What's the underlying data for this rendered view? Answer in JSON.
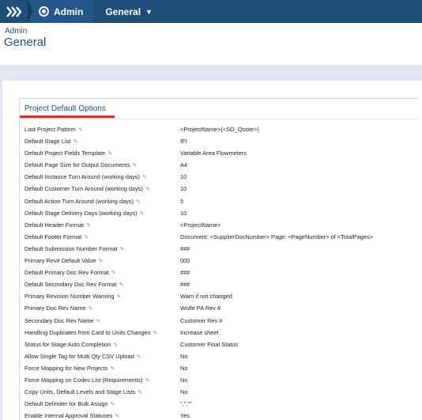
{
  "breadcrumb": {
    "items": [
      {
        "label": "Admin",
        "icon": "gear-icon"
      },
      {
        "label": "General",
        "icon": "chevron-down-icon"
      }
    ]
  },
  "header": {
    "subtitle": "Admin",
    "title": "General"
  },
  "section": {
    "title": "Project Default Options",
    "accent_color": "#e02b2b",
    "highlight_color": "#fbf58f"
  },
  "rows": [
    {
      "label": "Last Project Pattern",
      "value": "<ProjectName>(<SO_Quote>)"
    },
    {
      "label": "Default Stage List",
      "value": "IFI"
    },
    {
      "label": "Default Project Fields Template",
      "value": "Variable Area Flowmeters"
    },
    {
      "label": "Default Page Size for Output Documents",
      "value": "A4"
    },
    {
      "label": "Default Instance Turn Around (working days)",
      "value": "10"
    },
    {
      "label": "Default Customer Turn Around (working days)",
      "value": "10"
    },
    {
      "label": "Default Action Turn Around (working days)",
      "value": "5"
    },
    {
      "label": "Default Stage Delivery Days (working days)",
      "value": "10"
    },
    {
      "label": "Default Header Format",
      "value": "<ProjectName>"
    },
    {
      "label": "Default Footer Format",
      "value": "Document: <SupplierDocNumber> Page: <PageNumber> of <TotalPages>"
    },
    {
      "label": "Default Submission Number Format",
      "value": "###"
    },
    {
      "label": "Primary Rev# Default Value",
      "value": "000"
    },
    {
      "label": "Default Primary Doc Rev Format",
      "value": "###"
    },
    {
      "label": "Default Secondary Doc Rev Format",
      "value": "###"
    },
    {
      "label": "Primary Revision Number Warning",
      "value": "Warn if not changed"
    },
    {
      "label": "Primary Doc Rev Name",
      "value": "Wolfe PA Rev #"
    },
    {
      "label": "Secondary Doc Rev Name",
      "value": "Customer Rev #"
    },
    {
      "label": "Handling Duplicates from Card to Units Changes",
      "value": "Increase sheet"
    },
    {
      "label": "Status for Stage Auto Completion",
      "value": "Customer Final Status"
    },
    {
      "label": "Allow Single Tag for Multi Qty CSV Upload",
      "value": "No"
    },
    {
      "label": "Force Mapping for New Projects",
      "value": "No"
    },
    {
      "label": "Force Mapping on Codes List (Requirements)",
      "value": "No"
    },
    {
      "label": "Copy Units, Default Levels and Stage Lists",
      "value": "No"
    },
    {
      "label": "Default Delimiter for Bulk Assign",
      "value": "\",\",\"\""
    },
    {
      "label": "Enable Internal Approval Statuses",
      "value": "Yes"
    }
  ]
}
